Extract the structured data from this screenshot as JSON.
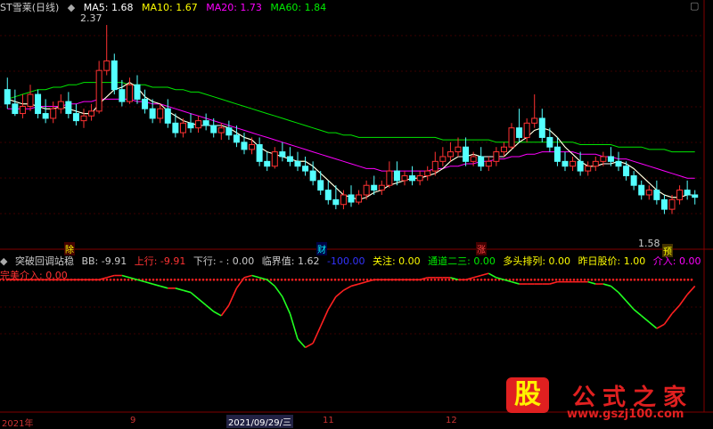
{
  "header": {
    "title": "ST雪莱(日线)",
    "ma5_label": "MA5: 1.68",
    "ma10_label": "MA10: 1.67",
    "ma20_label": "MA20: 1.73",
    "ma60_label": "MA60: 1.84",
    "high_marker": "2.37",
    "low_marker": "1.58"
  },
  "indicator": {
    "title": "突破回调站稳",
    "bb": "BB: -9.91",
    "up": "上行: -9.91",
    "down": "下行: - : 0.00",
    "critical": "临界值: 1.62",
    "neg100": "-100.00",
    "focus": "关注: 0.00",
    "channel": "通道二三: 0.00",
    "bull": "多头排列: 0.00",
    "prev_price": "昨日股价: 1.00",
    "enter": "介入: 0.00",
    "perfect": "完美介入: 0.00"
  },
  "tags": {
    "t1": "除",
    "t2": "财",
    "t3": "涨",
    "t4": "预"
  },
  "xaxis": {
    "l1": "2021年",
    "l2": "9",
    "l3": "2021/09/29/三",
    "l4": "11",
    "l5": "12"
  },
  "logo": {
    "mark": "股",
    "text": "公式之家",
    "url": "www.gszj100.com"
  },
  "colors": {
    "up": "#ff3232",
    "down": "#54ffff",
    "ma5": "#ffffff",
    "ma10": "#ffff00",
    "ma20": "#ff00ff",
    "ma60": "#00e600"
  },
  "chart_data": {
    "type": "candlestick",
    "ylim": [
      1.5,
      2.4
    ],
    "candles": [
      [
        2.1,
        2.15,
        2.04,
        2.02
      ],
      [
        2.04,
        2.1,
        2.0,
        1.99
      ],
      [
        2.0,
        2.08,
        2.03,
        1.98
      ],
      [
        2.03,
        2.12,
        2.08,
        2.01
      ],
      [
        2.08,
        2.1,
        2.0,
        1.98
      ],
      [
        2.0,
        2.06,
        1.98,
        1.96
      ],
      [
        1.98,
        2.05,
        2.02,
        1.96
      ],
      [
        2.02,
        2.08,
        2.05,
        2.0
      ],
      [
        2.05,
        2.09,
        2.0,
        1.98
      ],
      [
        2.0,
        2.04,
        1.97,
        1.95
      ],
      [
        1.97,
        2.02,
        1.99,
        1.94
      ],
      [
        1.99,
        2.04,
        2.01,
        1.97
      ],
      [
        2.01,
        2.22,
        2.18,
        2.0
      ],
      [
        2.18,
        2.37,
        2.22,
        2.16
      ],
      [
        2.22,
        2.25,
        2.1,
        2.08
      ],
      [
        2.1,
        2.14,
        2.05,
        2.03
      ],
      [
        2.05,
        2.15,
        2.12,
        2.04
      ],
      [
        2.12,
        2.16,
        2.06,
        2.04
      ],
      [
        2.06,
        2.1,
        2.02,
        2.0
      ],
      [
        2.02,
        2.06,
        1.98,
        1.96
      ],
      [
        1.98,
        2.04,
        2.02,
        1.96
      ],
      [
        2.02,
        2.06,
        1.96,
        1.94
      ],
      [
        1.96,
        2.0,
        1.92,
        1.9
      ],
      [
        1.92,
        1.98,
        1.96,
        1.9
      ],
      [
        1.96,
        2.0,
        1.94,
        1.92
      ],
      [
        1.94,
        1.99,
        1.97,
        1.92
      ],
      [
        1.97,
        2.0,
        1.95,
        1.93
      ],
      [
        1.95,
        1.98,
        1.92,
        1.9
      ],
      [
        1.92,
        1.96,
        1.94,
        1.89
      ],
      [
        1.94,
        1.97,
        1.91,
        1.89
      ],
      [
        1.91,
        1.95,
        1.88,
        1.86
      ],
      [
        1.88,
        1.92,
        1.85,
        1.83
      ],
      [
        1.85,
        1.9,
        1.87,
        1.83
      ],
      [
        1.87,
        1.9,
        1.8,
        1.78
      ],
      [
        1.8,
        1.84,
        1.78,
        1.76
      ],
      [
        1.78,
        1.86,
        1.84,
        1.77
      ],
      [
        1.84,
        1.88,
        1.82,
        1.8
      ],
      [
        1.82,
        1.86,
        1.8,
        1.78
      ],
      [
        1.8,
        1.84,
        1.78,
        1.76
      ],
      [
        1.78,
        1.82,
        1.76,
        1.74
      ],
      [
        1.76,
        1.8,
        1.72,
        1.7
      ],
      [
        1.72,
        1.76,
        1.68,
        1.66
      ],
      [
        1.68,
        1.72,
        1.64,
        1.62
      ],
      [
        1.64,
        1.7,
        1.62,
        1.6
      ],
      [
        1.62,
        1.68,
        1.66,
        1.6
      ],
      [
        1.66,
        1.7,
        1.63,
        1.61
      ],
      [
        1.63,
        1.68,
        1.66,
        1.62
      ],
      [
        1.66,
        1.72,
        1.7,
        1.64
      ],
      [
        1.7,
        1.74,
        1.68,
        1.66
      ],
      [
        1.68,
        1.72,
        1.7,
        1.66
      ],
      [
        1.7,
        1.8,
        1.76,
        1.69
      ],
      [
        1.76,
        1.8,
        1.72,
        1.7
      ],
      [
        1.72,
        1.76,
        1.74,
        1.7
      ],
      [
        1.74,
        1.78,
        1.72,
        1.7
      ],
      [
        1.72,
        1.76,
        1.74,
        1.7
      ],
      [
        1.74,
        1.78,
        1.76,
        1.72
      ],
      [
        1.76,
        1.84,
        1.8,
        1.74
      ],
      [
        1.8,
        1.86,
        1.82,
        1.78
      ],
      [
        1.82,
        1.88,
        1.84,
        1.8
      ],
      [
        1.84,
        1.9,
        1.86,
        1.82
      ],
      [
        1.86,
        1.9,
        1.8,
        1.78
      ],
      [
        1.8,
        1.84,
        1.82,
        1.78
      ],
      [
        1.82,
        1.86,
        1.78,
        1.76
      ],
      [
        1.78,
        1.82,
        1.8,
        1.76
      ],
      [
        1.8,
        1.86,
        1.84,
        1.78
      ],
      [
        1.84,
        1.88,
        1.86,
        1.82
      ],
      [
        1.86,
        1.96,
        1.94,
        1.85
      ],
      [
        1.94,
        2.02,
        1.9,
        1.88
      ],
      [
        1.9,
        1.98,
        1.96,
        1.88
      ],
      [
        1.96,
        2.08,
        1.98,
        1.94
      ],
      [
        1.98,
        2.02,
        1.9,
        1.88
      ],
      [
        1.9,
        1.94,
        1.86,
        1.84
      ],
      [
        1.86,
        1.9,
        1.8,
        1.78
      ],
      [
        1.8,
        1.84,
        1.78,
        1.76
      ],
      [
        1.78,
        1.82,
        1.8,
        1.76
      ],
      [
        1.8,
        1.84,
        1.76,
        1.74
      ],
      [
        1.76,
        1.8,
        1.78,
        1.74
      ],
      [
        1.78,
        1.82,
        1.8,
        1.76
      ],
      [
        1.8,
        1.84,
        1.82,
        1.78
      ],
      [
        1.82,
        1.86,
        1.8,
        1.78
      ],
      [
        1.8,
        1.84,
        1.78,
        1.76
      ],
      [
        1.78,
        1.8,
        1.74,
        1.72
      ],
      [
        1.74,
        1.76,
        1.7,
        1.68
      ],
      [
        1.7,
        1.72,
        1.66,
        1.64
      ],
      [
        1.66,
        1.7,
        1.68,
        1.64
      ],
      [
        1.68,
        1.72,
        1.64,
        1.62
      ],
      [
        1.64,
        1.66,
        1.6,
        1.58
      ],
      [
        1.6,
        1.66,
        1.64,
        1.58
      ],
      [
        1.64,
        1.7,
        1.68,
        1.62
      ],
      [
        1.68,
        1.72,
        1.66,
        1.64
      ],
      [
        1.66,
        1.68,
        1.65,
        1.62
      ]
    ],
    "ma5": [
      2.06,
      2.05,
      2.04,
      2.04,
      2.03,
      2.02,
      2.02,
      2.03,
      2.02,
      2.01,
      2.0,
      2.0,
      2.04,
      2.07,
      2.1,
      2.11,
      2.13,
      2.11,
      2.07,
      2.05,
      2.04,
      2.01,
      1.99,
      1.97,
      1.96,
      1.95,
      1.95,
      1.95,
      1.95,
      1.94,
      1.92,
      1.9,
      1.89,
      1.86,
      1.84,
      1.83,
      1.82,
      1.81,
      1.8,
      1.8,
      1.78,
      1.75,
      1.72,
      1.69,
      1.66,
      1.65,
      1.64,
      1.65,
      1.67,
      1.68,
      1.7,
      1.71,
      1.72,
      1.73,
      1.73,
      1.74,
      1.75,
      1.77,
      1.8,
      1.82,
      1.82,
      1.83,
      1.82,
      1.82,
      1.82,
      1.82,
      1.85,
      1.88,
      1.9,
      1.93,
      1.94,
      1.93,
      1.9,
      1.86,
      1.83,
      1.8,
      1.78,
      1.78,
      1.79,
      1.79,
      1.8,
      1.79,
      1.77,
      1.74,
      1.71,
      1.68,
      1.66,
      1.65,
      1.65,
      1.66,
      1.66
    ],
    "ma20": [
      2.02,
      2.02,
      2.02,
      2.02,
      2.03,
      2.03,
      2.03,
      2.03,
      2.04,
      2.04,
      2.05,
      2.05,
      2.06,
      2.06,
      2.06,
      2.06,
      2.06,
      2.05,
      2.05,
      2.04,
      2.04,
      2.03,
      2.02,
      2.01,
      2.0,
      1.99,
      1.98,
      1.97,
      1.96,
      1.95,
      1.94,
      1.93,
      1.92,
      1.91,
      1.9,
      1.89,
      1.88,
      1.87,
      1.86,
      1.85,
      1.84,
      1.83,
      1.82,
      1.81,
      1.8,
      1.79,
      1.78,
      1.77,
      1.77,
      1.76,
      1.76,
      1.76,
      1.76,
      1.76,
      1.76,
      1.76,
      1.77,
      1.77,
      1.78,
      1.78,
      1.79,
      1.79,
      1.8,
      1.8,
      1.81,
      1.81,
      1.82,
      1.82,
      1.83,
      1.83,
      1.84,
      1.84,
      1.84,
      1.84,
      1.84,
      1.83,
      1.83,
      1.83,
      1.82,
      1.82,
      1.81,
      1.81,
      1.8,
      1.79,
      1.78,
      1.77,
      1.76,
      1.75,
      1.74,
      1.73,
      1.73
    ],
    "ma60": [
      2.06,
      2.07,
      2.08,
      2.09,
      2.1,
      2.1,
      2.11,
      2.11,
      2.12,
      2.12,
      2.13,
      2.13,
      2.13,
      2.13,
      2.13,
      2.13,
      2.12,
      2.12,
      2.12,
      2.11,
      2.11,
      2.11,
      2.1,
      2.1,
      2.09,
      2.09,
      2.08,
      2.07,
      2.06,
      2.05,
      2.04,
      2.03,
      2.02,
      2.01,
      2.0,
      1.99,
      1.98,
      1.97,
      1.96,
      1.95,
      1.94,
      1.93,
      1.92,
      1.92,
      1.91,
      1.91,
      1.9,
      1.9,
      1.9,
      1.9,
      1.9,
      1.9,
      1.9,
      1.9,
      1.9,
      1.9,
      1.9,
      1.89,
      1.89,
      1.89,
      1.89,
      1.89,
      1.89,
      1.89,
      1.88,
      1.88,
      1.88,
      1.88,
      1.88,
      1.88,
      1.88,
      1.88,
      1.88,
      1.88,
      1.88,
      1.87,
      1.87,
      1.87,
      1.87,
      1.87,
      1.86,
      1.86,
      1.86,
      1.86,
      1.85,
      1.85,
      1.85,
      1.84,
      1.84,
      1.84,
      1.84
    ],
    "bb": [
      0.0,
      0.0,
      0.0,
      0.0,
      0.0,
      0.0,
      0.0,
      0.0,
      0.0,
      0.0,
      0.0,
      0.0,
      0.0,
      0.5,
      1.0,
      1.0,
      0.5,
      0.0,
      -0.5,
      -1.0,
      -1.5,
      -2.0,
      -2.0,
      -2.5,
      -3.0,
      -4.5,
      -6.0,
      -7.5,
      -8.5,
      -6.0,
      -2.0,
      0.5,
      1.0,
      0.5,
      0.0,
      -1.5,
      -4.0,
      -8.0,
      -14.0,
      -16.0,
      -15.0,
      -11.0,
      -7.0,
      -4.0,
      -2.5,
      -1.5,
      -1.0,
      -0.5,
      0.0,
      0.0,
      0.0,
      0.0,
      0.0,
      0.0,
      0.0,
      0.5,
      0.5,
      0.5,
      0.5,
      0.0,
      0.0,
      0.5,
      1.0,
      1.5,
      0.5,
      0.0,
      -0.5,
      -1.0,
      -1.0,
      -1.0,
      -1.0,
      -1.0,
      -0.5,
      -0.5,
      -0.5,
      -0.5,
      -0.5,
      -1.0,
      -1.0,
      -1.5,
      -3.0,
      -5.0,
      -7.0,
      -8.5,
      -10.0,
      -11.5,
      -10.5,
      -8.0,
      -6.0,
      -3.5,
      -1.5
    ],
    "bb_ylim": [
      -18,
      3
    ]
  }
}
